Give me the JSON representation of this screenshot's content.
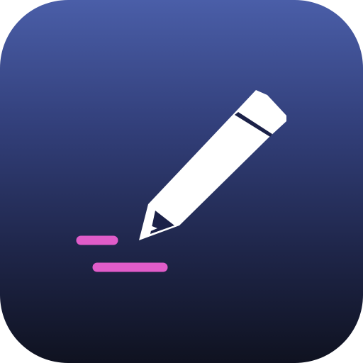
{
  "app_icon": {
    "symbol": "pencil-icon",
    "colors": {
      "background_top": "#4a5ea8",
      "background_bottom": "#0f1220",
      "pencil": "#ffffff",
      "pencil_shadow": "#1b2148",
      "stroke_marks": "#e05cc9"
    },
    "stroke_marks_count": 2
  }
}
